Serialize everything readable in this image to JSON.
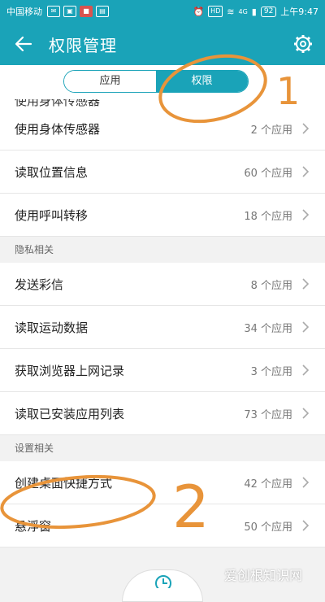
{
  "status": {
    "carrier": "中国移动",
    "battery": "92",
    "time": "上午9:47",
    "hd": "HD",
    "net": "4G"
  },
  "header": {
    "title": "权限管理"
  },
  "tabs": [
    {
      "label": "应用"
    },
    {
      "label": "权限"
    }
  ],
  "partial_item": {
    "label": "使用身体传感器"
  },
  "groups": [
    {
      "items": [
        {
          "label": "使用身体传感器",
          "count": "2 个应用"
        },
        {
          "label": "读取位置信息",
          "count": "60 个应用"
        },
        {
          "label": "使用呼叫转移",
          "count": "18 个应用"
        }
      ]
    },
    {
      "title": "隐私相关",
      "items": [
        {
          "label": "发送彩信",
          "count": "8 个应用"
        },
        {
          "label": "读取运动数据",
          "count": "34 个应用"
        },
        {
          "label": "获取浏览器上网记录",
          "count": "3 个应用"
        },
        {
          "label": "读取已安装应用列表",
          "count": "73 个应用"
        }
      ]
    },
    {
      "title": "设置相关",
      "items": [
        {
          "label": "创建桌面快捷方式",
          "count": "42 个应用"
        },
        {
          "label": "悬浮窗",
          "count": "50 个应用"
        }
      ]
    }
  ],
  "annotations": {
    "mark1": "1",
    "mark2": "2"
  },
  "watermark": "爱创根知识网",
  "colors": {
    "accent": "#1aa3b8",
    "annotation": "#e8943a"
  }
}
